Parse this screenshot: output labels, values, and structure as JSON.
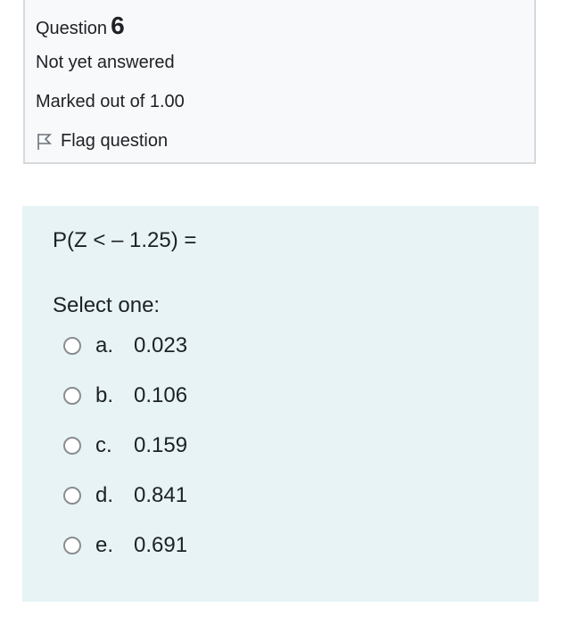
{
  "info": {
    "question_label": "Question",
    "question_number": "6",
    "status": "Not yet answered",
    "marks": "Marked out of 1.00",
    "flag_label": "Flag question"
  },
  "question": {
    "text": "P(Z < – 1.25) =",
    "prompt": "Select one:",
    "options": [
      {
        "letter": "a.",
        "value": "0.023"
      },
      {
        "letter": "b.",
        "value": "0.106"
      },
      {
        "letter": "c.",
        "value": "0.159"
      },
      {
        "letter": "d.",
        "value": "0.841"
      },
      {
        "letter": "e.",
        "value": "0.691"
      }
    ]
  },
  "icons": {
    "flag": "flag-icon",
    "radio": "radio-unchecked-icon"
  },
  "colors": {
    "info_background": "#f8f9fa",
    "info_border": "#d7d9dc",
    "content_background": "#e7f3f5",
    "text": "#1d2125"
  }
}
